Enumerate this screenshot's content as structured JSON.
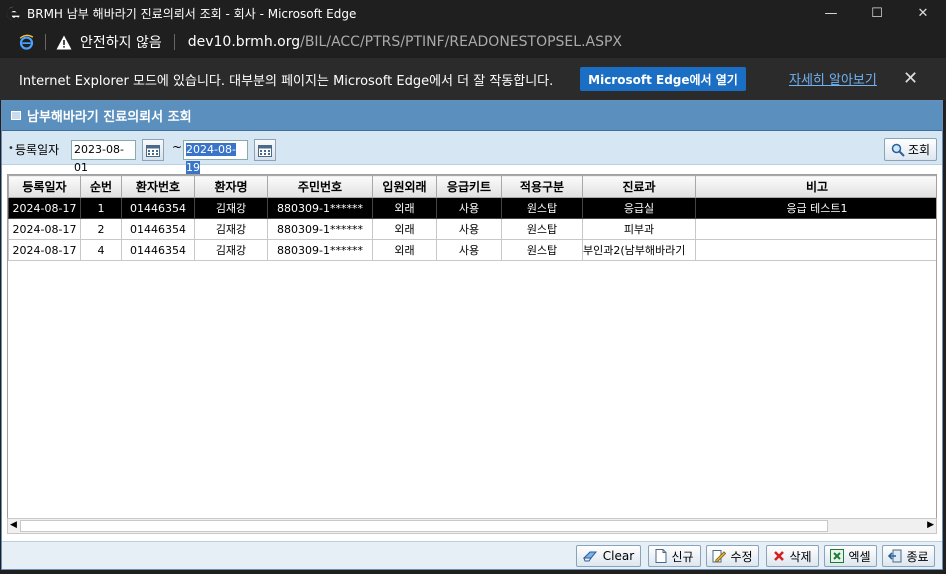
{
  "window": {
    "title": "BRMH 남부 해바라기 진료의뢰서 조회 - 회사 - Microsoft Edge",
    "minimize": "—",
    "maximize": "☐",
    "close": "✕"
  },
  "address": {
    "security_text": "안전하지 않음",
    "host": "dev10.brmh.org",
    "path": "/BIL/ACC/PTRS/PTINF/READONESTOPSEL.ASPX"
  },
  "ie_bar": {
    "message": "Internet Explorer 모드에 있습니다. 대부분의 페이지는 Microsoft Edge에서 더 잘 작동합니다.",
    "open_button": "Microsoft Edge에서 열기",
    "learn_more": "자세히 알아보기",
    "close": "✕"
  },
  "panel": {
    "title": "남부해바라기 진료의뢰서 조회"
  },
  "filter": {
    "label": "등록일자",
    "date_from": "2023-08-01",
    "date_to": "2024-08-19",
    "tilde": "~",
    "search_button": "조회"
  },
  "grid": {
    "columns": [
      "등록일자",
      "순번",
      "환자번호",
      "환자명",
      "주민번호",
      "입원외래",
      "응급키트",
      "적용구분",
      "진료과",
      "비고"
    ],
    "rows": [
      [
        "2024-08-17",
        "1",
        "01446354",
        "김재강",
        "880309-1******",
        "외래",
        "사용",
        "원스탑",
        "응급실",
        "응급 테스트1"
      ],
      [
        "2024-08-17",
        "2",
        "01446354",
        "김재강",
        "880309-1******",
        "외래",
        "사용",
        "원스탑",
        "피부과",
        ""
      ],
      [
        "2024-08-17",
        "4",
        "01446354",
        "김재강",
        "880309-1******",
        "외래",
        "사용",
        "원스탑",
        "부인과2(남부해바라기",
        ""
      ]
    ]
  },
  "toolbar": {
    "clear": "Clear",
    "new": "신규",
    "edit": "수정",
    "delete": "삭제",
    "excel": "엑셀",
    "exit": "종료"
  }
}
